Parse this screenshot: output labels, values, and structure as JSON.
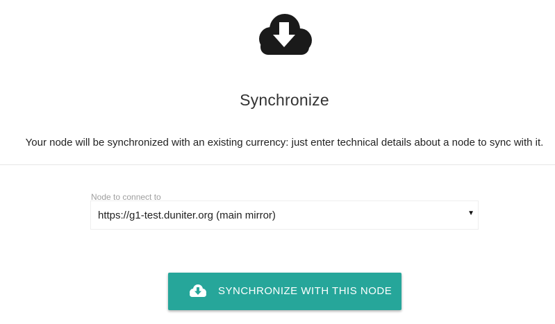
{
  "header": {
    "icon": "cloud-download-icon",
    "title": "Synchronize",
    "description": "Your node will be synchronized with an existing currency: just enter technical details about a node to sync with it."
  },
  "form": {
    "node_label": "Node to connect to",
    "node_selected": "https://g1-test.duniter.org (main mirror)",
    "dropdown_icon": "triangle-down-icon"
  },
  "action": {
    "button_label": "SYNCHRONIZE WITH THIS NODE",
    "button_icon": "cloud-download-icon",
    "button_color": "#26a69a"
  },
  "colors": {
    "hero_icon": "#1a1a1a",
    "accent": "#26a69a",
    "divider": "#e6e6e6"
  }
}
